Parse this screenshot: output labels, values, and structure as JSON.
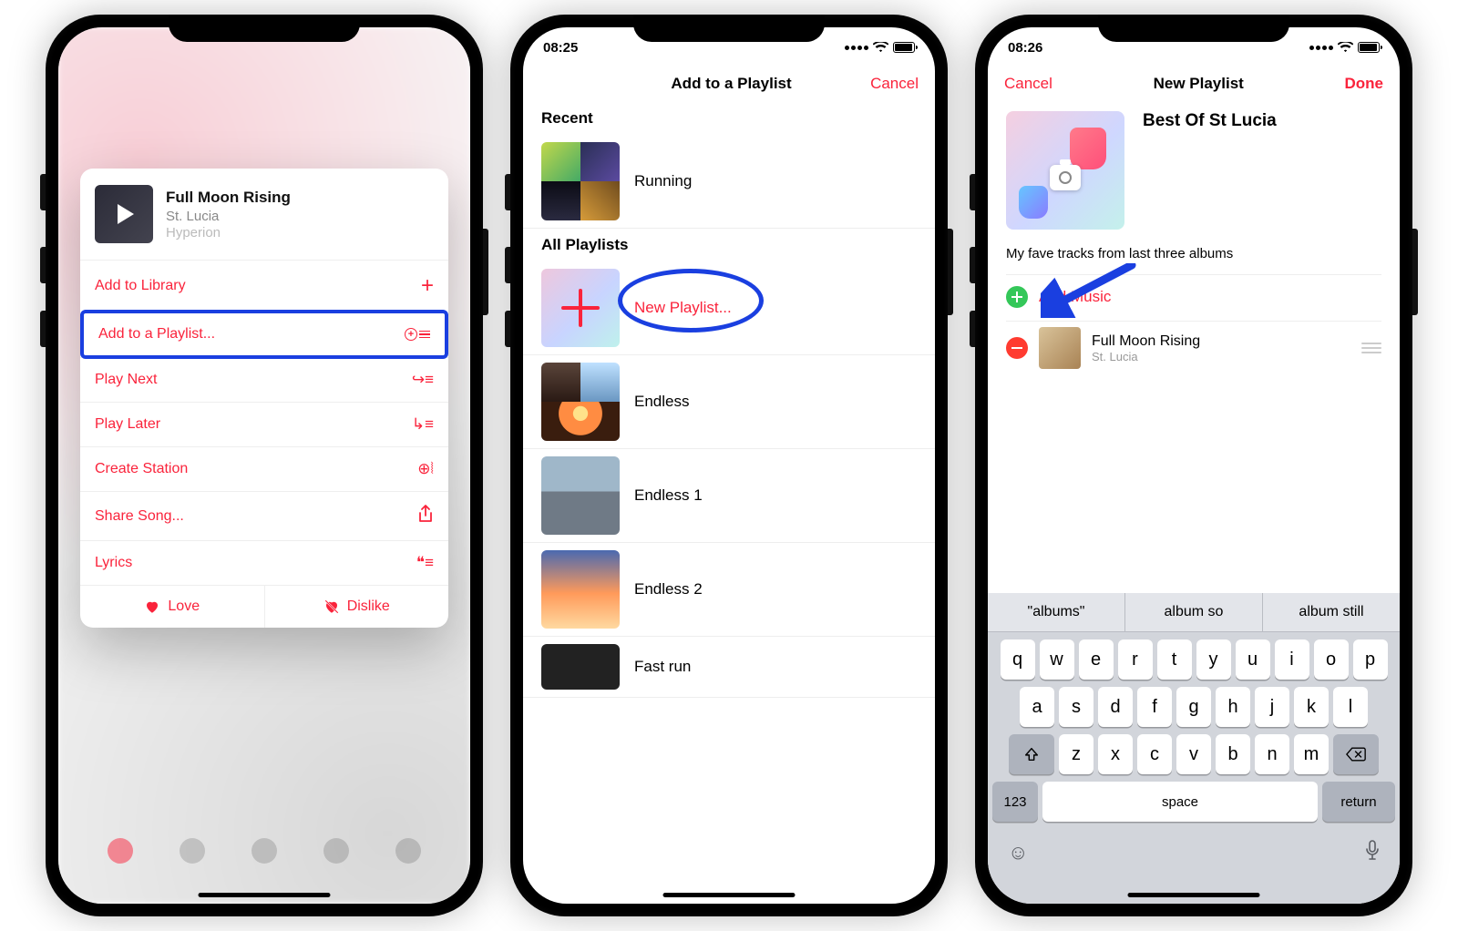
{
  "screen1": {
    "song": {
      "title": "Full Moon Rising",
      "artist": "St. Lucia",
      "album": "Hyperion"
    },
    "menu": {
      "addToLibrary": "Add to Library",
      "addToPlaylist": "Add to a Playlist...",
      "playNext": "Play Next",
      "playLater": "Play Later",
      "createStation": "Create Station",
      "shareSong": "Share Song...",
      "lyrics": "Lyrics",
      "love": "Love",
      "dislike": "Dislike"
    }
  },
  "screen2": {
    "statusTime": "08:25",
    "header": {
      "title": "Add to a Playlist",
      "cancel": "Cancel"
    },
    "sections": {
      "recent": "Recent",
      "all": "All Playlists"
    },
    "newPlaylist": "New Playlist...",
    "playlists": {
      "recent": [
        "Running"
      ],
      "all": [
        "Endless",
        "Endless 1",
        "Endless 2",
        "Fast run"
      ]
    }
  },
  "screen3": {
    "statusTime": "08:26",
    "header": {
      "cancel": "Cancel",
      "title": "New Playlist",
      "done": "Done"
    },
    "playlistName": "Best Of St Lucia",
    "description": "My fave tracks from last three albums",
    "addMusic": "Add Music",
    "track": {
      "title": "Full Moon Rising",
      "artist": "St. Lucia"
    },
    "keyboard": {
      "suggestions": [
        "\"albums\"",
        "album so",
        "album still"
      ],
      "row1": [
        "q",
        "w",
        "e",
        "r",
        "t",
        "y",
        "u",
        "i",
        "o",
        "p"
      ],
      "row2": [
        "a",
        "s",
        "d",
        "f",
        "g",
        "h",
        "j",
        "k",
        "l"
      ],
      "row3": [
        "z",
        "x",
        "c",
        "v",
        "b",
        "n",
        "m"
      ],
      "numKey": "123",
      "space": "space",
      "returnKey": "return"
    }
  }
}
